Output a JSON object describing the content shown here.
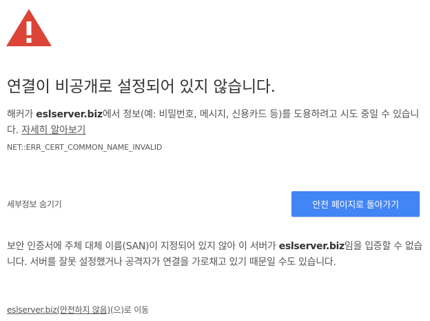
{
  "icon": {
    "name": "warning-triangle-icon",
    "color": "#db4437"
  },
  "title": "연결이 비공개로 설정되어 있지 않습니다.",
  "description": {
    "part1": "해커가 ",
    "domain": "eslserver.biz",
    "part2": "에서 정보(예: 비밀번호, 메시지, 신용카드 등)를 도용하려고 시도 중일 수 있습니다. ",
    "learn_more": "자세히 알아보기"
  },
  "error_code": "NET::ERR_CERT_COMMON_NAME_INVALID",
  "buttons": {
    "details": "세부정보 숨기기",
    "back_to_safety": "안전 페이지로 돌아가기",
    "primary_color": "#4285f4"
  },
  "details": {
    "part1": "보안 인증서에 주체 대체 이름(SAN)이 지정되어 있지 않아 이 서버가 ",
    "domain": "eslserver.biz",
    "part2": "임을 입증할 수 없습니다. 서버를 잘못 설정했거나 공격자가 연결을 가로채고 있기 때문일 수도 있습니다."
  },
  "proceed": {
    "link": "eslserver.biz(안전하지 않음)",
    "suffix": "(으)로 이동"
  }
}
